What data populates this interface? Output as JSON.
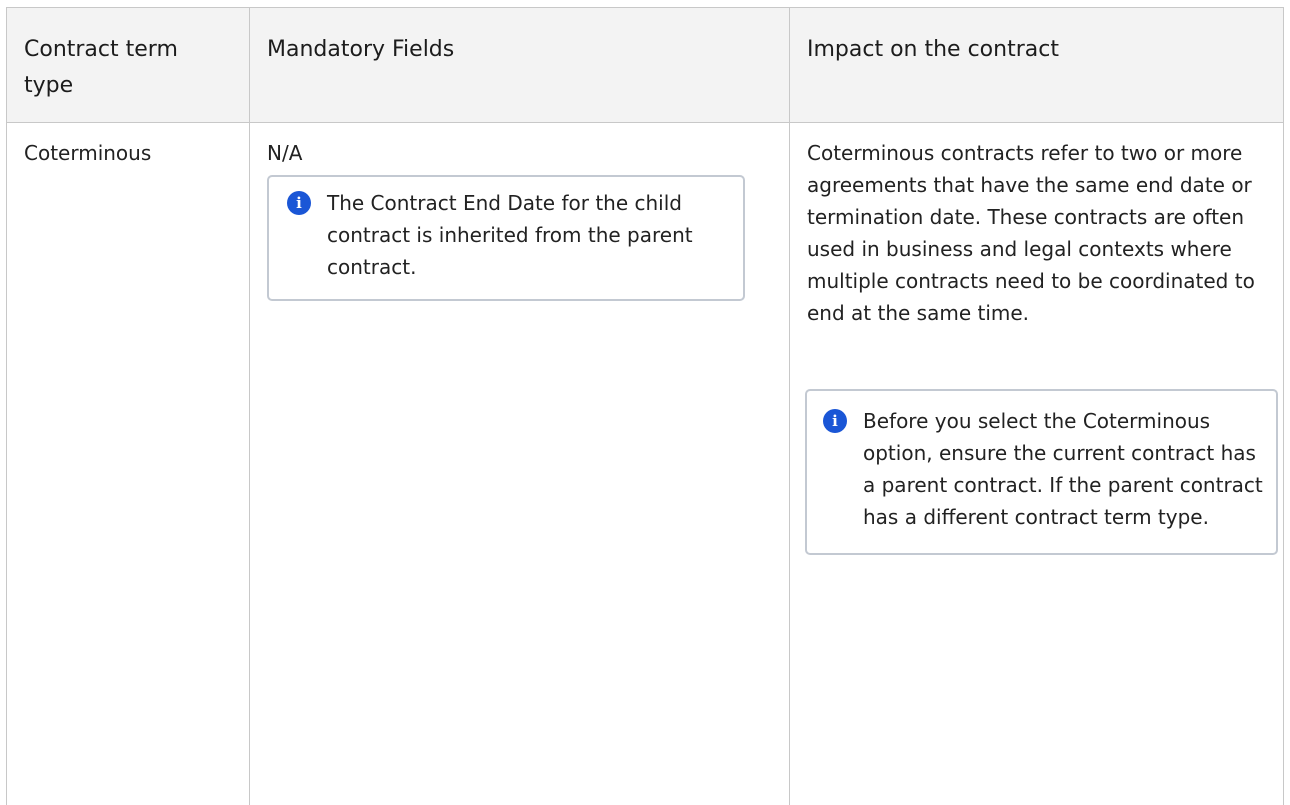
{
  "table": {
    "headers": {
      "term_type": "Contract term type",
      "mandatory_fields": "Mandatory Fields",
      "impact": "Impact on the contract"
    },
    "row": {
      "term_type": "Coterminous",
      "mandatory_fields": "N/A",
      "mandatory_note": "The Contract End Date for the child contract is inherited from the parent contract.",
      "impact": "Coterminous contracts refer to two or more agreements that have the same end date or termination date. These contracts are often used in business and legal contexts where multiple contracts need to be coordinated to end at the same time.",
      "impact_note": "Before you select the Coterminous option, ensure the current contract has a parent contract. If the parent contract has a different contract term type."
    }
  },
  "icons": {
    "note_icon": "info-icon",
    "note_icon_color": "#1a56d6"
  }
}
